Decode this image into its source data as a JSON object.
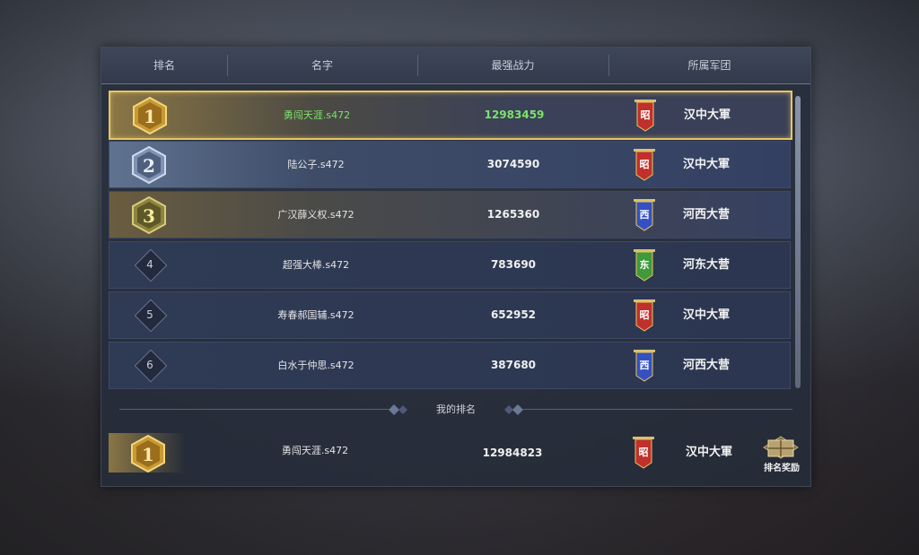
{
  "header": {
    "columns": [
      "排名",
      "名字",
      "最强战力",
      "所属军团"
    ]
  },
  "rows": [
    {
      "rank": "1",
      "name": "勇闯天涯.s472",
      "power": "12983459",
      "banner_char": "昭",
      "banner_color": "#c0302c",
      "legion": "汉中大軍"
    },
    {
      "rank": "2",
      "name": "陆公子.s472",
      "power": "3074590",
      "banner_char": "昭",
      "banner_color": "#c0302c",
      "legion": "汉中大軍"
    },
    {
      "rank": "3",
      "name": "广汉薛义权.s472",
      "power": "1265360",
      "banner_char": "西",
      "banner_color": "#3550c0",
      "legion": "河西大营"
    },
    {
      "rank": "4",
      "name": "超强大棒.s472",
      "power": "783690",
      "banner_char": "东",
      "banner_color": "#3e9a3a",
      "legion": "河东大营"
    },
    {
      "rank": "5",
      "name": "寿春郝国辅.s472",
      "power": "652952",
      "banner_char": "昭",
      "banner_color": "#c0302c",
      "legion": "汉中大軍"
    },
    {
      "rank": "6",
      "name": "白水于仲思.s472",
      "power": "387680",
      "banner_char": "西",
      "banner_color": "#3550c0",
      "legion": "河西大营"
    }
  ],
  "my_rank": {
    "section_label": "我的排名",
    "rank": "1",
    "name": "勇闯天涯.s472",
    "power": "12984823",
    "banner_char": "昭",
    "banner_color": "#c0302c",
    "legion": "汉中大軍"
  },
  "reward_button": {
    "label": "排名奖励",
    "icon": "treasure-chest-icon"
  },
  "colors": {
    "gold": "#e6c566",
    "silver": "#8fa4c4",
    "bronze": "#b49a55",
    "highlight_green": "#7be36a"
  }
}
